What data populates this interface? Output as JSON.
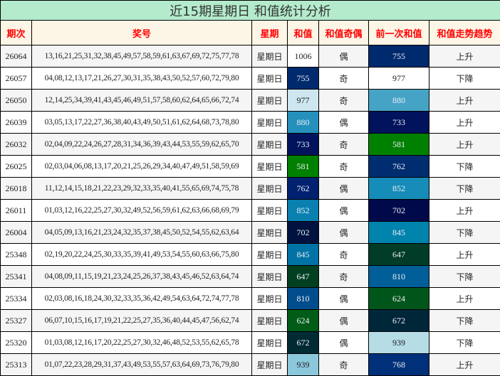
{
  "title": "近15期星期日 和值统计分析",
  "headers": [
    "期次",
    "奖号",
    "星期",
    "和值",
    "和值奇偶",
    "前一次和值",
    "和值走势趋势"
  ],
  "rows": [
    {
      "period": "26064",
      "numbers": "13,16,21,25,31,32,38,45,49,57,58,59,61,63,67,69,72,75,77,78",
      "weekday": "星期日",
      "sum": "1006",
      "sum_color": "#ffffff",
      "parity": "偶",
      "prev": "755",
      "prev_color": "#002a6e",
      "trend": "上升"
    },
    {
      "period": "26057",
      "numbers": "04,08,12,13,17,21,26,27,30,31,35,38,43,50,52,57,60,72,79,80",
      "weekday": "星期日",
      "sum": "755",
      "sum_color": "#002a6e",
      "parity": "奇",
      "prev": "977",
      "prev_color": "#ffffff",
      "trend": "下降"
    },
    {
      "period": "26050",
      "numbers": "12,14,25,34,39,41,43,45,46,49,51,57,58,60,62,64,65,66,72,74",
      "weekday": "星期日",
      "sum": "977",
      "sum_color": "#cde6f0",
      "parity": "奇",
      "prev": "880",
      "prev_color": "#45a3c6",
      "trend": "上升"
    },
    {
      "period": "26039",
      "numbers": "03,05,13,17,22,27,36,38,40,43,49,50,51,61,62,64,68,73,78,80",
      "weekday": "星期日",
      "sum": "880",
      "sum_color": "#2590bc",
      "parity": "偶",
      "prev": "733",
      "prev_color": "#00135c",
      "trend": "上升"
    },
    {
      "period": "26032",
      "numbers": "02,04,09,22,24,26,27,28,31,34,36,39,43,44,53,55,59,62,65,70",
      "weekday": "星期日",
      "sum": "733",
      "sum_color": "#00135c",
      "parity": "奇",
      "prev": "581",
      "prev_color": "#008000",
      "trend": "上升"
    },
    {
      "period": "26025",
      "numbers": "02,03,04,06,08,13,17,20,21,25,26,29,34,40,47,49,51,58,59,69",
      "weekday": "星期日",
      "sum": "581",
      "sum_color": "#008000",
      "parity": "奇",
      "prev": "762",
      "prev_color": "#002d70",
      "trend": "下降"
    },
    {
      "period": "26018",
      "numbers": "11,12,14,15,18,21,22,23,29,32,33,35,40,41,55,65,69,74,75,78",
      "weekday": "星期日",
      "sum": "762",
      "sum_color": "#002070",
      "parity": "偶",
      "prev": "852",
      "prev_color": "#168cb8",
      "trend": "下降"
    },
    {
      "period": "26011",
      "numbers": "01,03,12,16,22,25,27,30,32,49,52,56,59,61,62,63,66,68,69,79",
      "weekday": "星期日",
      "sum": "852",
      "sum_color": "#0a80b0",
      "parity": "偶",
      "prev": "702",
      "prev_color": "#000a4a",
      "trend": "上升"
    },
    {
      "period": "26004",
      "numbers": "04,05,09,13,16,21,23,24,32,35,37,38,45,50,52,54,55,62,63,64",
      "weekday": "星期日",
      "sum": "702",
      "sum_color": "#001240",
      "parity": "偶",
      "prev": "845",
      "prev_color": "#0083ad",
      "trend": "下降"
    },
    {
      "period": "25348",
      "numbers": "02,19,20,22,24,25,30,33,35,39,41,49,53,54,55,60,63,66,75,80",
      "weekday": "星期日",
      "sum": "845",
      "sum_color": "#0072a6",
      "parity": "奇",
      "prev": "647",
      "prev_color": "#003c28",
      "trend": "上升"
    },
    {
      "period": "25341",
      "numbers": "04,08,09,11,15,19,21,23,24,25,26,37,38,43,45,46,52,63,64,74",
      "weekday": "星期日",
      "sum": "647",
      "sum_color": "#004020",
      "parity": "奇",
      "prev": "810",
      "prev_color": "#005f98",
      "trend": "下降"
    },
    {
      "period": "25334",
      "numbers": "02,03,08,16,18,24,30,32,33,35,36,42,49,54,63,64,72,74,77,78",
      "weekday": "星期日",
      "sum": "810",
      "sum_color": "#004c8c",
      "parity": "偶",
      "prev": "624",
      "prev_color": "#00561a",
      "trend": "上升"
    },
    {
      "period": "25327",
      "numbers": "06,07,10,15,16,17,19,21,22,25,27,35,36,40,44,45,47,56,62,74",
      "weekday": "星期日",
      "sum": "624",
      "sum_color": "#005c16",
      "parity": "偶",
      "prev": "672",
      "prev_color": "#00263a",
      "trend": "下降"
    },
    {
      "period": "25320",
      "numbers": "01,03,08,12,16,17,20,22,25,27,30,32,46,48,52,53,55,62,65,78",
      "weekday": "星期日",
      "sum": "672",
      "sum_color": "#002a34",
      "parity": "偶",
      "prev": "939",
      "prev_color": "#b6dce6",
      "trend": "下降"
    },
    {
      "period": "25313",
      "numbers": "01,07,22,23,28,29,31,37,43,49,53,55,57,63,64,69,73,76,79,80",
      "weekday": "星期日",
      "sum": "939",
      "sum_color": "#8cc8dc",
      "parity": "奇",
      "prev": "768",
      "prev_color": "#00307a",
      "trend": "上升"
    }
  ]
}
